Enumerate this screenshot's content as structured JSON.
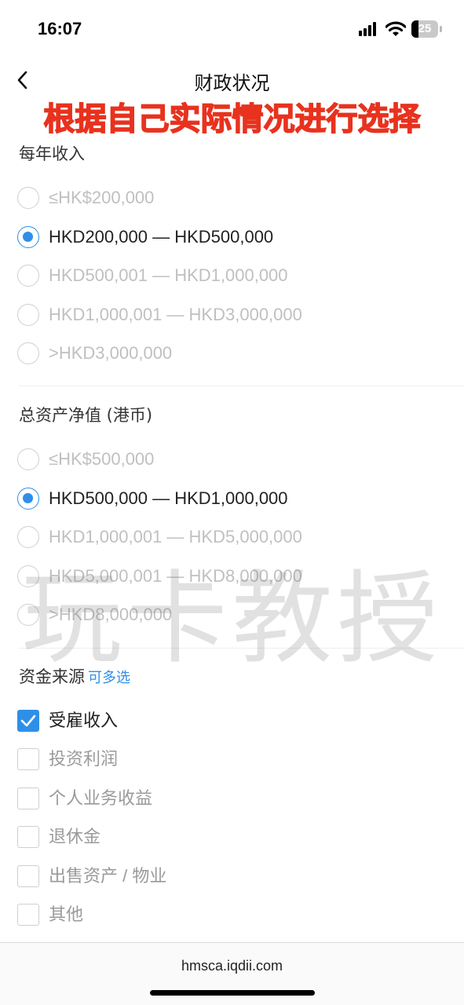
{
  "status_bar": {
    "time": "16:07",
    "battery": "25"
  },
  "nav": {
    "title": "财政状况"
  },
  "overlay": {
    "banner": "根据自己实际情况进行选择",
    "watermark": "玩卡教授"
  },
  "annual_income": {
    "title": "每年收入",
    "options": [
      {
        "label": "≤HK$200,000",
        "selected": false
      },
      {
        "label": "HKD200,000 — HKD500,000",
        "selected": true
      },
      {
        "label": "HKD500,001 — HKD1,000,000",
        "selected": false
      },
      {
        "label": "HKD1,000,001 — HKD3,000,000",
        "selected": false
      },
      {
        "label": ">HKD3,000,000",
        "selected": false
      }
    ]
  },
  "net_assets": {
    "title": "总资产净值 (港币)",
    "options": [
      {
        "label": "≤HK$500,000",
        "selected": false
      },
      {
        "label": "HKD500,000 — HKD1,000,000",
        "selected": true
      },
      {
        "label": "HKD1,000,001 — HKD5,000,000",
        "selected": false
      },
      {
        "label": "HKD5,000,001 — HKD8,000,000",
        "selected": false
      },
      {
        "label": ">HKD8,000,000",
        "selected": false
      }
    ]
  },
  "fund_source": {
    "title": "资金来源",
    "hint": "可多选",
    "options": [
      {
        "label": "受雇收入",
        "checked": true
      },
      {
        "label": "投资利润",
        "checked": false
      },
      {
        "label": "个人业务收益",
        "checked": false
      },
      {
        "label": "退休金",
        "checked": false
      },
      {
        "label": "出售资产 / 物业",
        "checked": false
      },
      {
        "label": "其他",
        "checked": false
      }
    ]
  },
  "footer": {
    "url": "hmsca.iqdii.com"
  },
  "colors": {
    "accent": "#2f8fe8",
    "banner": "#e8321e",
    "inactive_text": "#c0c0c0"
  },
  "icons": [
    "signal-icon",
    "wifi-icon",
    "battery-icon",
    "back-arrow-icon",
    "checkmark-icon"
  ]
}
